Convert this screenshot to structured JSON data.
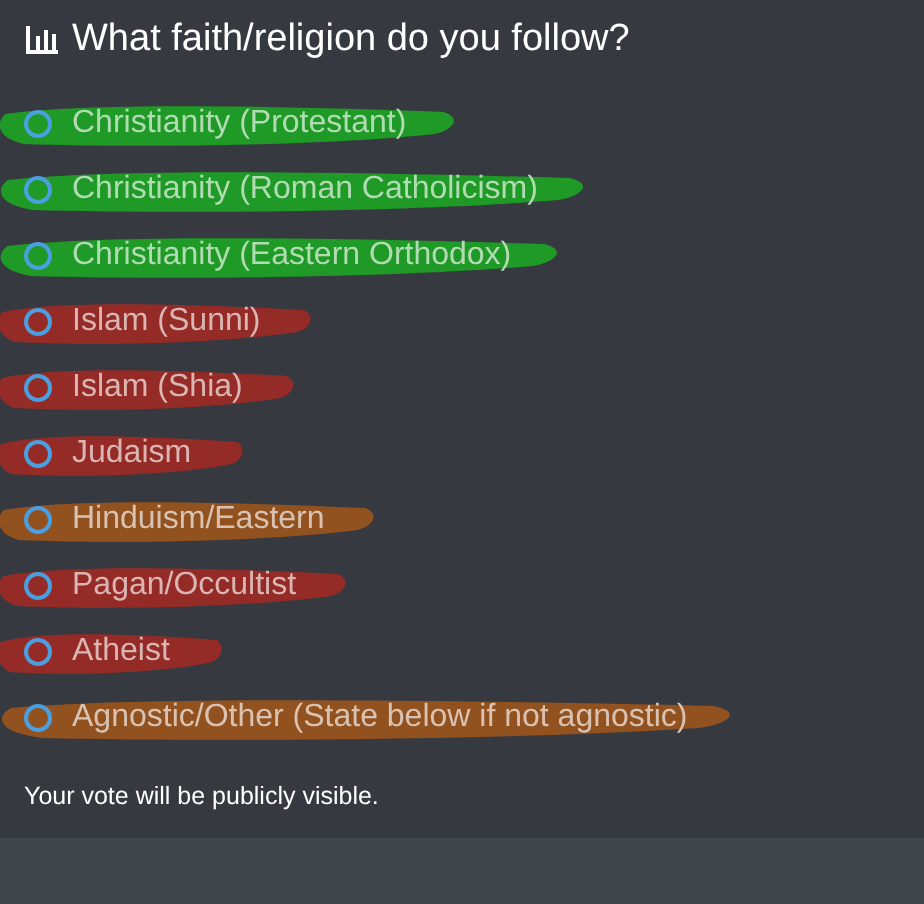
{
  "poll": {
    "question": "What faith/religion do you follow?",
    "options": [
      {
        "label": "Christianity (Protestant)",
        "selected": false,
        "color": "#1f9a26"
      },
      {
        "label": "Christianity (Roman Catholicism)",
        "selected": false,
        "color": "#1f9a26"
      },
      {
        "label": "Christianity (Eastern Orthodox)",
        "selected": false,
        "color": "#1f9a26"
      },
      {
        "label": "Islam (Sunni)",
        "selected": false,
        "color": "#952b26"
      },
      {
        "label": "Islam (Shia)",
        "selected": false,
        "color": "#952b26"
      },
      {
        "label": "Judaism",
        "selected": false,
        "color": "#952b26"
      },
      {
        "label": "Hinduism/Eastern",
        "selected": false,
        "color": "#92521f"
      },
      {
        "label": "Pagan/Occultist",
        "selected": false,
        "color": "#952b26"
      },
      {
        "label": "Atheist",
        "selected": false,
        "color": "#952b26"
      },
      {
        "label": "Agnostic/Other (State below if not agnostic)",
        "selected": false,
        "color": "#92521f"
      }
    ],
    "footer": "Your vote will be publicly visible."
  }
}
